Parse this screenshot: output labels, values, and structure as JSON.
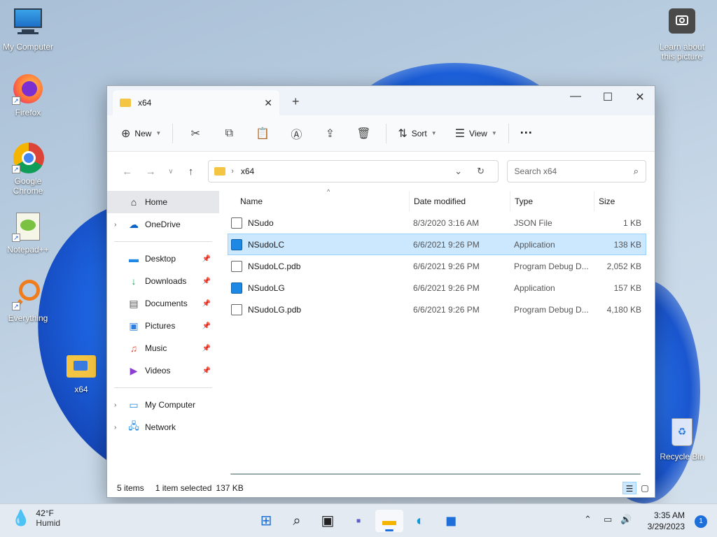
{
  "desktop": {
    "icons": [
      {
        "label": "My Computer",
        "icon": "monitor-icon"
      },
      {
        "label": "Firefox",
        "icon": "firefox-icon"
      },
      {
        "label": "Google Chrome",
        "icon": "chrome-icon"
      },
      {
        "label": "Notepad++",
        "icon": "notepadpp-icon"
      },
      {
        "label": "Everything",
        "icon": "everything-icon"
      },
      {
        "label": "x64",
        "icon": "folder-icon"
      },
      {
        "label": "Learn about this picture",
        "icon": "camera-icon"
      },
      {
        "label": "Recycle Bin",
        "icon": "recycle-bin-icon"
      }
    ]
  },
  "window": {
    "tab_title": "x64",
    "new_tab": "+",
    "minimize": "—",
    "maximize": "☐",
    "close": "✕"
  },
  "toolbar": {
    "new_label": "New",
    "sort_label": "Sort",
    "view_label": "View",
    "more": "···"
  },
  "address": {
    "path": "x64",
    "search_placeholder": "Search x64"
  },
  "sidebar": {
    "home": "Home",
    "onedrive": "OneDrive",
    "quick": [
      {
        "label": "Desktop",
        "icon": "desktop-icon"
      },
      {
        "label": "Downloads",
        "icon": "download-icon"
      },
      {
        "label": "Documents",
        "icon": "documents-icon"
      },
      {
        "label": "Pictures",
        "icon": "pictures-icon"
      },
      {
        "label": "Music",
        "icon": "music-icon"
      },
      {
        "label": "Videos",
        "icon": "videos-icon"
      }
    ],
    "my_computer": "My Computer",
    "network": "Network"
  },
  "columns": {
    "name": "Name",
    "date": "Date modified",
    "type": "Type",
    "size": "Size"
  },
  "files": [
    {
      "name": "NSudo",
      "date": "8/3/2020 3:16 AM",
      "type": "JSON File",
      "size": "1 KB",
      "icon": "json-file-icon",
      "selected": false
    },
    {
      "name": "NSudoLC",
      "date": "6/6/2021 9:26 PM",
      "type": "Application",
      "size": "138 KB",
      "icon": "app-icon",
      "selected": true
    },
    {
      "name": "NSudoLC.pdb",
      "date": "6/6/2021 9:26 PM",
      "type": "Program Debug D...",
      "size": "2,052 KB",
      "icon": "file-icon",
      "selected": false
    },
    {
      "name": "NSudoLG",
      "date": "6/6/2021 9:26 PM",
      "type": "Application",
      "size": "157 KB",
      "icon": "app-icon",
      "selected": false
    },
    {
      "name": "NSudoLG.pdb",
      "date": "6/6/2021 9:26 PM",
      "type": "Program Debug D...",
      "size": "4,180 KB",
      "icon": "file-icon",
      "selected": false
    }
  ],
  "status": {
    "items": "5 items",
    "selected": "1 item selected",
    "size": "137 KB"
  },
  "taskbar": {
    "temp": "42°F",
    "weather": "Humid",
    "time": "3:35 AM",
    "date": "3/29/2023",
    "notifications": "1"
  }
}
